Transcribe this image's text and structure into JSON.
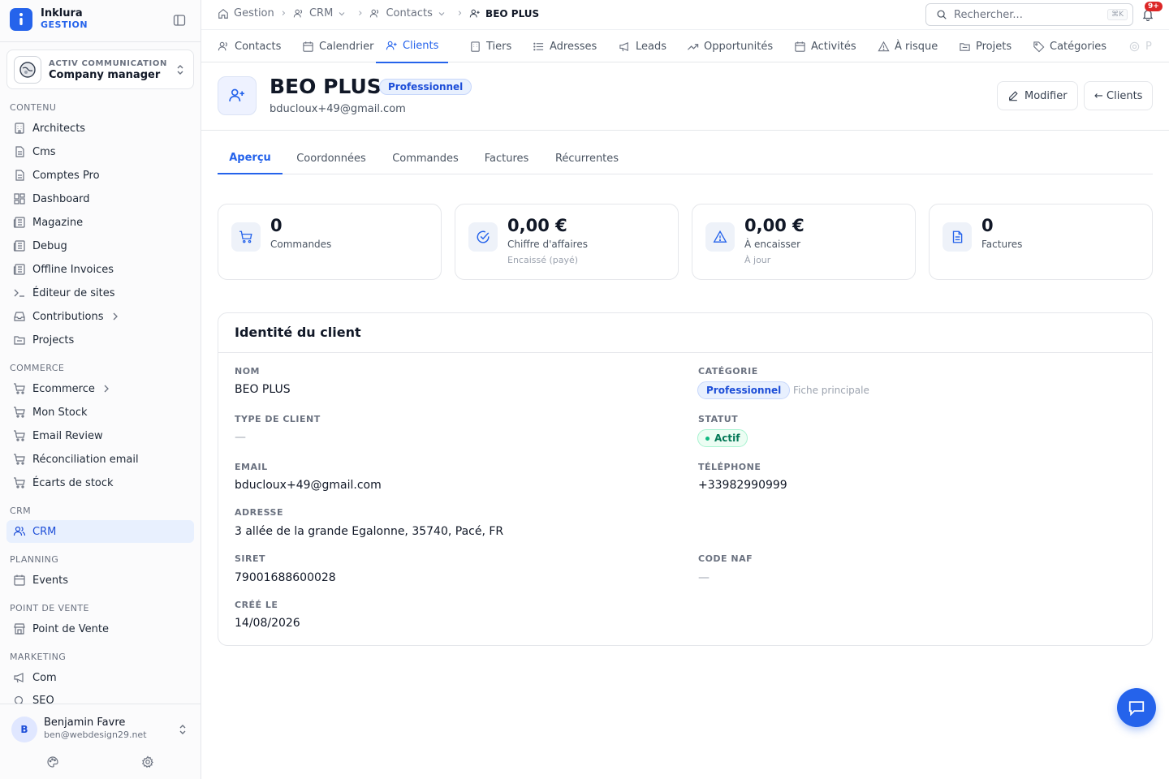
{
  "brand": {
    "name": "Inklura",
    "sub": "GESTION"
  },
  "org": {
    "sub": "ACTIV COMMUNICATION",
    "name": "Company manager"
  },
  "sections": {
    "contenu": "CONTENU",
    "commerce": "COMMERCE",
    "crm": "CRM",
    "planning": "PLANNING",
    "pdv": "POINT DE VENTE",
    "marketing": "MARKETING"
  },
  "nav": {
    "architects": "Architects",
    "cms": "Cms",
    "comptes_pro": "Comptes Pro",
    "dashboard": "Dashboard",
    "magazine": "Magazine",
    "debug": "Debug",
    "offline_invoices": "Offline Invoices",
    "editeur": "Éditeur de sites",
    "contributions": "Contributions",
    "projects": "Projects",
    "ecommerce": "Ecommerce",
    "mon_stock": "Mon Stock",
    "email_review": "Email Review",
    "reconciliation": "Réconciliation email",
    "ecarts": "Écarts de stock",
    "crm": "CRM",
    "events": "Events",
    "point_de_vente": "Point de Vente",
    "com": "Com",
    "seo": "SEO"
  },
  "user": {
    "initial": "B",
    "name": "Benjamin Favre",
    "email": "ben@webdesign29.net"
  },
  "breadcrumb": {
    "gestion": "Gestion",
    "crm": "CRM",
    "contacts": "Contacts",
    "current": "BEO PLUS"
  },
  "search": {
    "placeholder": "Rechercher...",
    "shortcut": "⌘K"
  },
  "notifications": {
    "badge": "9+"
  },
  "module_tabs": {
    "contacts": "Contacts",
    "calendrier": "Calendrier",
    "clients": "Clients",
    "tiers": "Tiers",
    "adresses": "Adresses",
    "leads": "Leads",
    "opportunites": "Opportunités",
    "activites": "Activités",
    "a_risque": "À risque",
    "projets": "Projets",
    "categories": "Catégories",
    "more": "P"
  },
  "client": {
    "name": "BEO PLUS",
    "badge": "Professionnel",
    "email": "bducloux+49@gmail.com",
    "edit_label": "Modifier",
    "back_label": "← Clients"
  },
  "content_tabs": {
    "apercu": "Aperçu",
    "coordonnees": "Coordonnées",
    "commandes": "Commandes",
    "factures": "Factures",
    "recurrentes": "Récurrentes"
  },
  "stats": {
    "commandes": {
      "value": "0",
      "label": "Commandes"
    },
    "ca": {
      "value": "0,00 €",
      "label": "Chiffre d'affaires",
      "sub": "Encaissé (payé)"
    },
    "encaisser": {
      "value": "0,00 €",
      "label": "À encaisser",
      "sub": "À jour"
    },
    "factures": {
      "value": "0",
      "label": "Factures"
    }
  },
  "identity": {
    "title": "Identité du client",
    "nom_label": "NOM",
    "nom": "BEO PLUS",
    "categorie_label": "CATÉGORIE",
    "categorie": "Professionnel",
    "categorie_note": "Fiche principale",
    "type_label": "TYPE DE CLIENT",
    "type": "—",
    "statut_label": "STATUT",
    "statut": "Actif",
    "email_label": "EMAIL",
    "email": "bducloux+49@gmail.com",
    "telephone_label": "TÉLÉPHONE",
    "telephone": "+33982990999",
    "adresse_label": "ADRESSE",
    "adresse": "3 allée de la grande Egalonne, 35740, Pacé, FR",
    "siret_label": "SIRET",
    "siret": "79001688600028",
    "naf_label": "CODE NAF",
    "naf": "—",
    "cree_label": "CRÉÉ LE",
    "cree": "14/08/2026"
  },
  "colors": {
    "accent": "#2563eb",
    "success": "#10b981",
    "danger": "#dc2626"
  }
}
